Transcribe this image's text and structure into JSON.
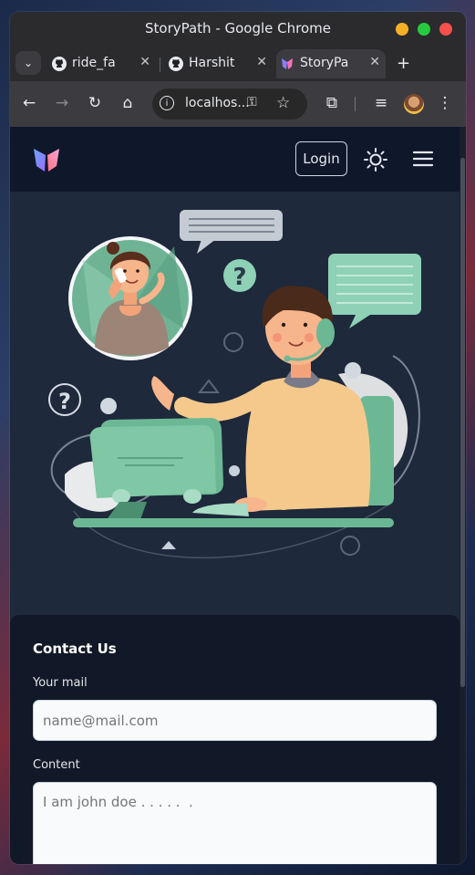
{
  "window": {
    "title": "StoryPath - Google Chrome"
  },
  "tabs": [
    {
      "label": "ride_fa",
      "icon": "github-icon"
    },
    {
      "label": "Harshit",
      "icon": "github-icon"
    },
    {
      "label": "StoryPa",
      "icon": "storypath-logo-icon",
      "active": true
    }
  ],
  "toolbar": {
    "url": "localhos..."
  },
  "navbar": {
    "login_label": "Login"
  },
  "contact": {
    "title": "Contact Us",
    "email_label": "Your mail",
    "email_placeholder": "name@mail.com",
    "content_label": "Content",
    "content_placeholder": "I am john doe . . . . .  ."
  },
  "colors": {
    "page_bg": "#1e293b",
    "navbar_bg": "#0f172a",
    "card_bg": "#111827",
    "accent_green": "#6cb894",
    "shirt": "#f5c98b"
  }
}
